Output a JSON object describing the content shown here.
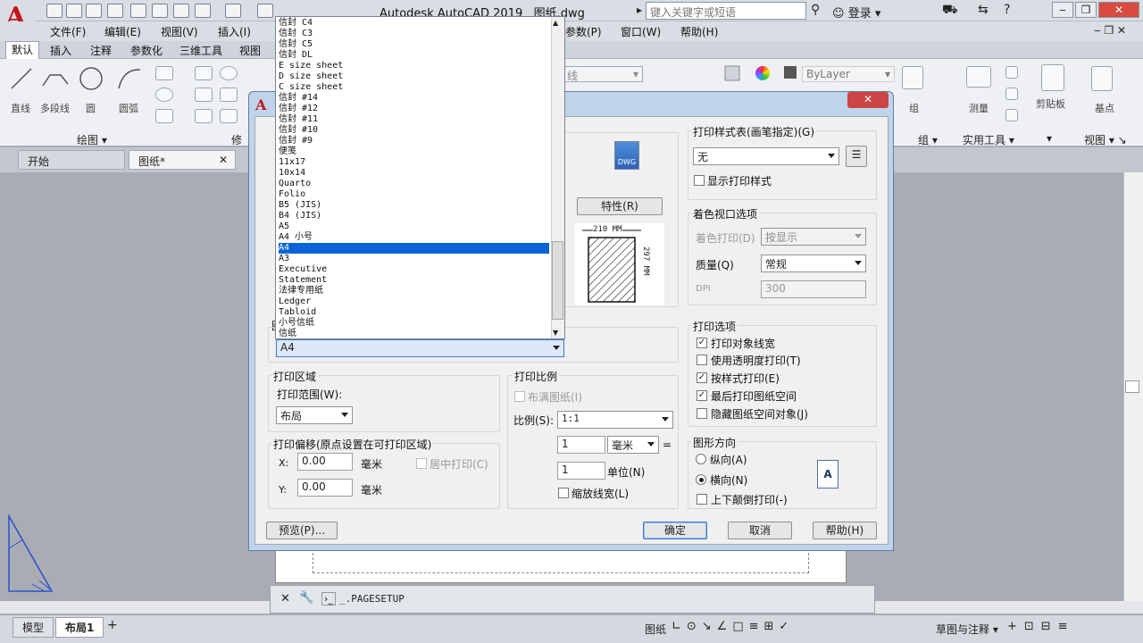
{
  "app": {
    "title": "Autodesk AutoCAD 2019",
    "file": "图纸.dwg",
    "search_placeholder": "键入关键字或短语",
    "login": "登录"
  },
  "menus": [
    "文件(F)",
    "编辑(E)",
    "视图(V)",
    "插入(I)",
    "参数(P)",
    "窗口(W)",
    "帮助(H)"
  ],
  "ribbon_tabs": [
    "默认",
    "插入",
    "注释",
    "参数化",
    "三维工具",
    "视图"
  ],
  "ribbon": {
    "draw_tools": [
      "直线",
      "多段线",
      "圆",
      "圆弧"
    ],
    "draw_group": "绘图",
    "modify_group": "修",
    "layer_value": "线",
    "bylayer": "ByLayer",
    "group_tool": "组",
    "measure_tool": "测量",
    "clipboard_tool": "剪贴板",
    "base_tool": "基点",
    "group_panel": "组",
    "utilities_panel": "实用工具",
    "view_panel": "视图"
  },
  "file_tabs": [
    "开始",
    "图纸*"
  ],
  "dialog": {
    "close_label": "✕",
    "letter": "A",
    "initial": "图",
    "dwg_label": "DWG",
    "properties_button": "特性(R)",
    "paper_dims": {
      "width": "210 MM",
      "height": "297 MM"
    },
    "paper_size_value": "A4",
    "print_area": {
      "title": "打印区域",
      "range_label": "打印范围(W):",
      "range_value": "布局"
    },
    "offset": {
      "title": "打印偏移(原点设置在可打印区域)",
      "x_label": "X:",
      "x_value": "0.00",
      "y_label": "Y:",
      "y_value": "0.00",
      "unit": "毫米",
      "center": "居中打印(C)"
    },
    "scale": {
      "title": "打印比例",
      "fit": "布满图纸(I)",
      "ratio_label": "比例(S):",
      "ratio_value": "1:1",
      "num": "1",
      "unit": "毫米",
      "equals": "=",
      "den": "1",
      "den_unit": "单位(N)",
      "lineweight": "缩放线宽(L)"
    },
    "style_table": {
      "title": "打印样式表(画笔指定)(G)",
      "value": "无",
      "show": "显示打印样式"
    },
    "shaded": {
      "title": "着色视口选项",
      "shade_label": "着色打印(D)",
      "shade_value": "按显示",
      "quality_label": "质量(Q)",
      "quality_value": "常规",
      "dpi_label": "DPI",
      "dpi_value": "300"
    },
    "options": {
      "title": "打印选项",
      "items": [
        {
          "label": "打印对象线宽",
          "checked": true
        },
        {
          "label": "使用透明度打印(T)",
          "checked": false
        },
        {
          "label": "按样式打印(E)",
          "checked": true
        },
        {
          "label": "最后打印图纸空间",
          "checked": true
        },
        {
          "label": "隐藏图纸空间对象(J)",
          "checked": false
        }
      ]
    },
    "orientation": {
      "title": "图形方向",
      "portrait": "纵向(A)",
      "landscape": "横向(N)",
      "upside": "上下颠倒打印(-)"
    },
    "buttons": {
      "preview": "预览(P)...",
      "ok": "确定",
      "cancel": "取消",
      "help": "帮助(H)"
    }
  },
  "dropdown": {
    "items": [
      "信封 C4",
      "信封 C3",
      "信封 C5",
      "信封 DL",
      "E size sheet",
      "D size sheet",
      "C size sheet",
      "信封 #14",
      "信封 #12",
      "信封 #11",
      "信封 #10",
      "信封 #9",
      "便笺",
      "11x17",
      "10x14",
      "Quarto",
      "Folio",
      "B5 (JIS)",
      "B4 (JIS)",
      "A5",
      "A4 小号",
      "A4",
      "A3",
      "Executive",
      "Statement",
      "法律专用纸",
      "Ledger",
      "Tabloid",
      "小号信纸",
      "信纸"
    ],
    "selected_index": 21
  },
  "command": {
    "text": "_.PAGESETUP"
  },
  "layout_tabs": [
    "模型",
    "布局1"
  ],
  "status": {
    "paper": "图纸",
    "workspace": "草图与注释"
  }
}
